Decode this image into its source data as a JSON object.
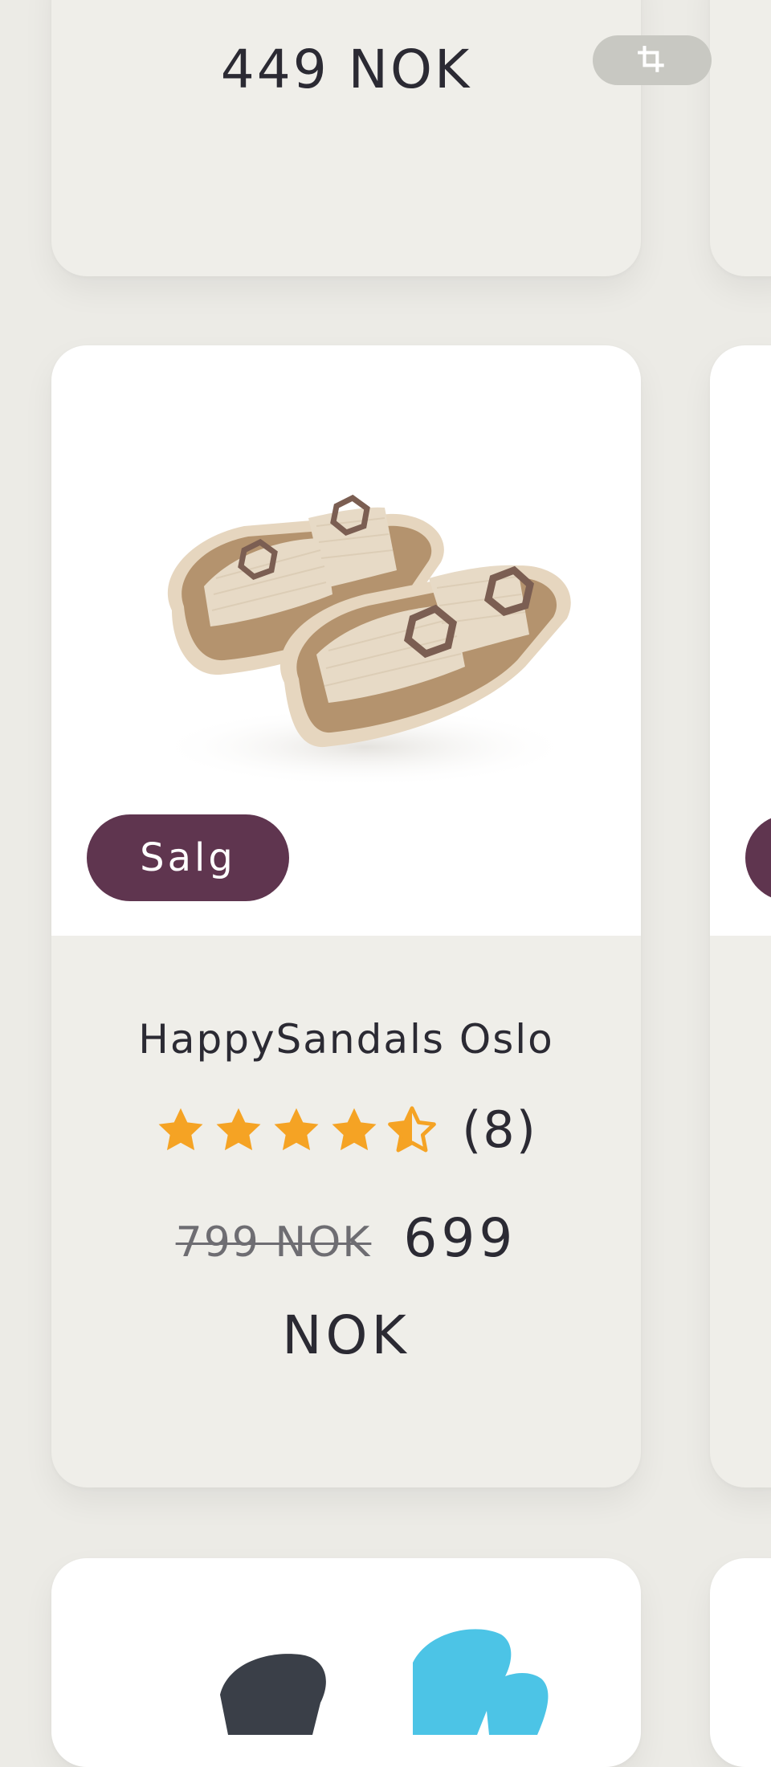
{
  "cards": [
    {
      "price": "449 NOK",
      "crop_icon": "crop-icon"
    },
    {
      "badge": "Salg",
      "title": "HappySandals Oslo",
      "rating": 4.5,
      "review_count": "(8)",
      "old_price": "799 NOK",
      "new_price": "699 NOK"
    }
  ],
  "colors": {
    "background": "#ecebe6",
    "card": "#efeee9",
    "badge": "#5f354f",
    "star": "#f5a324",
    "text": "#2b2a33"
  }
}
